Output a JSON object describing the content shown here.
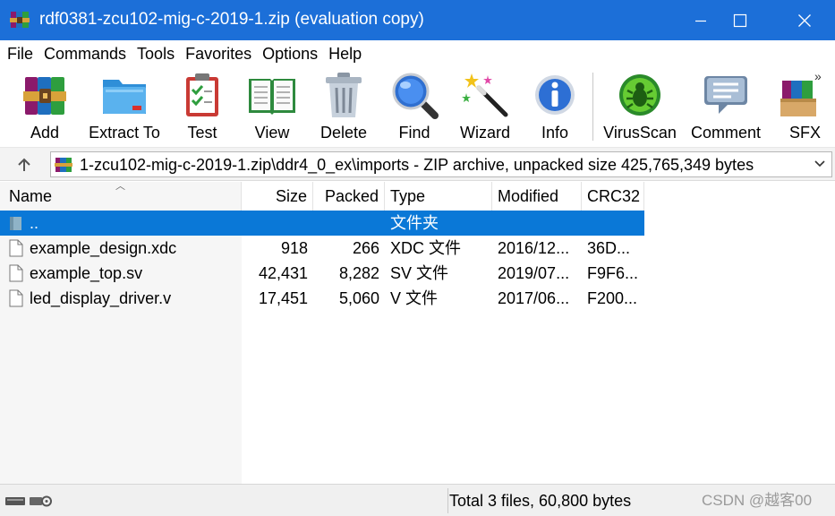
{
  "window": {
    "title": "rdf0381-zcu102-mig-c-2019-1.zip (evaluation copy)",
    "accent_color": "#1c6fd8"
  },
  "menu": [
    "File",
    "Commands",
    "Tools",
    "Favorites",
    "Options",
    "Help"
  ],
  "toolbar": {
    "buttons": [
      {
        "label": "Add",
        "icon": "archive-books-icon"
      },
      {
        "label": "Extract To",
        "icon": "folder-icon"
      },
      {
        "label": "Test",
        "icon": "checklist-icon"
      },
      {
        "label": "View",
        "icon": "book-icon"
      },
      {
        "label": "Delete",
        "icon": "trash-icon"
      },
      {
        "label": "Find",
        "icon": "magnifier-icon"
      },
      {
        "label": "Wizard",
        "icon": "magic-wand-icon"
      },
      {
        "label": "Info",
        "icon": "info-icon"
      },
      {
        "label": "VirusScan",
        "icon": "bug-icon"
      },
      {
        "label": "Comment",
        "icon": "speech-bubble-icon"
      },
      {
        "label": "SFX",
        "icon": "sfx-box-icon"
      }
    ],
    "overflow": "»"
  },
  "address": {
    "path": "1-zcu102-mig-c-2019-1.zip\\ddr4_0_ex\\imports - ZIP archive, unpacked size 425,765,349 bytes"
  },
  "columns": {
    "name": "Name",
    "size": "Size",
    "packed": "Packed",
    "type": "Type",
    "modified": "Modified",
    "crc": "CRC32"
  },
  "files": [
    {
      "name": "..",
      "size": "",
      "packed": "",
      "type": "文件夹",
      "modified": "",
      "crc": "",
      "selected": true
    },
    {
      "name": "example_design.xdc",
      "size": "918",
      "packed": "266",
      "type": "XDC 文件",
      "modified": "2016/12...",
      "crc": "36D..."
    },
    {
      "name": "example_top.sv",
      "size": "42,431",
      "packed": "8,282",
      "type": "SV 文件",
      "modified": "2019/07...",
      "crc": "F9F6..."
    },
    {
      "name": "led_display_driver.v",
      "size": "17,451",
      "packed": "5,060",
      "type": "V 文件",
      "modified": "2017/06...",
      "crc": "F200..."
    }
  ],
  "status": {
    "summary": "Total 3 files, 60,800 bytes",
    "watermark": "CSDN @越客00"
  }
}
